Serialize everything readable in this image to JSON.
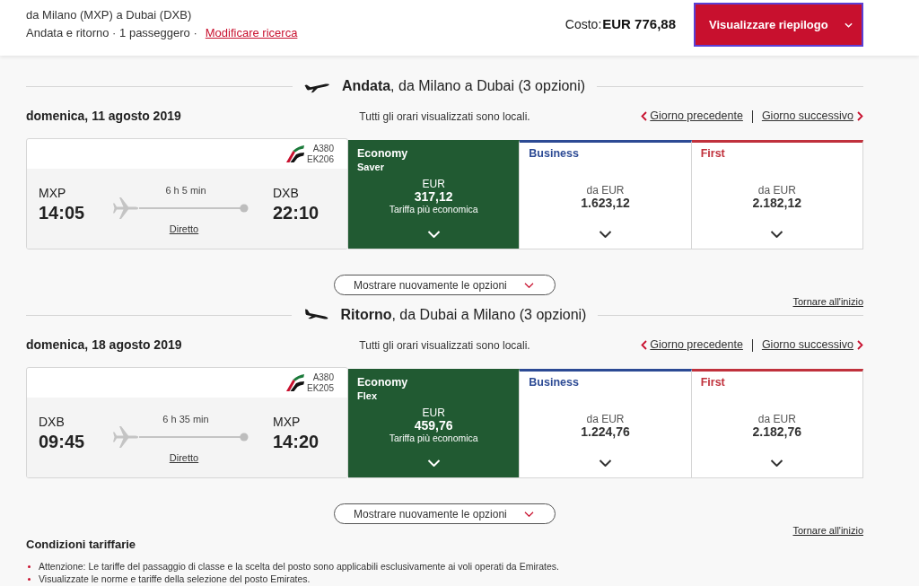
{
  "header": {
    "route": "da Milano (MXP) a Dubai (DXB)",
    "trip_details": "Andata e ritorno · 1 passeggero ·",
    "modify_search_link": "Modificare ricerca",
    "cost_label": "Costo:",
    "cost_value": "EUR 776,88",
    "summary_button": "Visualizzare riepilogo"
  },
  "legs": [
    {
      "kind": "outbound",
      "heading": "**Andata**, da Milano a Dubai (3 opzioni)",
      "date": "domenica, 11 agosto 2019",
      "local_times_note": "Tutti gli orari visualizzati sono locali.",
      "previous_day_link": "Giorno precedente",
      "next_day_link": "Giorno successivo",
      "flight": {
        "aircraft": "A380",
        "flight_number": "EK206",
        "origin": "MXP",
        "departure_time": "14:05",
        "duration": "6 h 5 min",
        "stops": "Diretto",
        "destination": "DXB",
        "arrival_time": "22:10"
      },
      "fares": [
        {
          "cabin": "Economy",
          "fare_type": "Saver",
          "price_prefix": "EUR",
          "price": "317,12",
          "note": "Tariffa più economica",
          "color": "#215a32",
          "selected": true
        },
        {
          "cabin": "Business",
          "price_prefix": "da EUR",
          "price": "1.623,12",
          "color": "#2c4a94",
          "selected": false
        },
        {
          "cabin": "First",
          "price_prefix": "da EUR",
          "price": "2.182,12",
          "color": "#c0313c",
          "selected": false
        }
      ],
      "show_options_button": "Mostrare nuovamente le opzioni",
      "back_to_top_link": "Tornare all'inizio"
    },
    {
      "kind": "return",
      "heading": "**Ritorno**, da Dubai a Milano (3 opzioni)",
      "date": "domenica, 18 agosto 2019",
      "local_times_note": "Tutti gli orari visualizzati sono locali.",
      "previous_day_link": "Giorno precedente",
      "next_day_link": "Giorno successivo",
      "flight": {
        "aircraft": "A380",
        "flight_number": "EK205",
        "origin": "DXB",
        "departure_time": "09:45",
        "duration": "6 h 35 min",
        "stops": "Diretto",
        "destination": "MXP",
        "arrival_time": "14:20"
      },
      "fares": [
        {
          "cabin": "Economy",
          "fare_type": "Flex",
          "price_prefix": "EUR",
          "price": "459,76",
          "note": "Tariffa più economica",
          "color": "#215a32",
          "selected": true
        },
        {
          "cabin": "Business",
          "price_prefix": "da EUR",
          "price": "1.224,76",
          "color": "#2c4a94",
          "selected": false
        },
        {
          "cabin": "First",
          "price_prefix": "da EUR",
          "price": "2.182,76",
          "color": "#c0313c",
          "selected": false
        }
      ],
      "show_options_button": "Mostrare nuovamente le opzioni",
      "back_to_top_link": "Tornare all'inizio"
    }
  ],
  "fare_conditions": {
    "title": "Condizioni tariffarie",
    "items": [
      "Attenzione: Le tariffe del passaggio di classe e la scelta del posto sono applicabili esclusivamente ai voli operati da Emirates.",
      "Visualizzate le norme e tariffe della selezione del posto Emirates."
    ]
  }
}
